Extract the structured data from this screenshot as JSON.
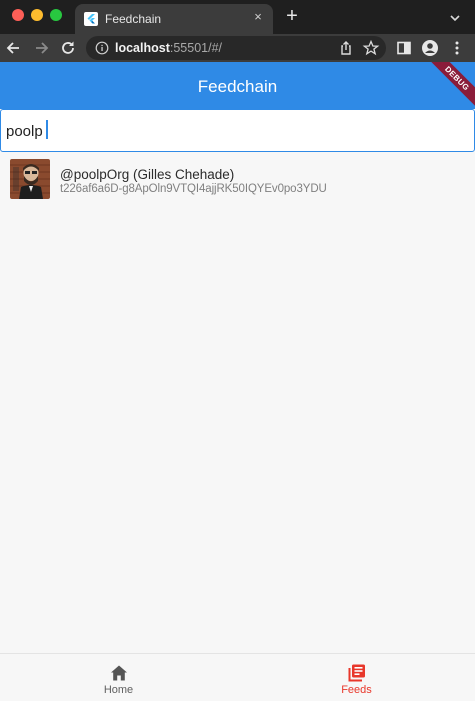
{
  "browser": {
    "tab_title": "Feedchain",
    "close_glyph": "×",
    "new_tab_glyph": "+",
    "url_host": "localhost",
    "url_rest": ":55501/#/"
  },
  "app": {
    "title": "Feedchain",
    "debug_label": "DEBUG",
    "search": {
      "value": "poolp",
      "placeholder": ""
    },
    "results": [
      {
        "name": "@poolpOrg (Gilles Chehade)",
        "key": "t226af6a6D-g8ApOln9VTQI4ajjRK50IQYEv0po3YDU"
      }
    ],
    "bottom_nav": [
      {
        "label": "Home",
        "icon": "home-icon",
        "active": false
      },
      {
        "label": "Feeds",
        "icon": "feeds-icon",
        "active": true
      }
    ]
  },
  "colors": {
    "appbar": "#2f8ae6",
    "active_nav": "#e8372b",
    "debug_banner": "#8a1c3a"
  }
}
